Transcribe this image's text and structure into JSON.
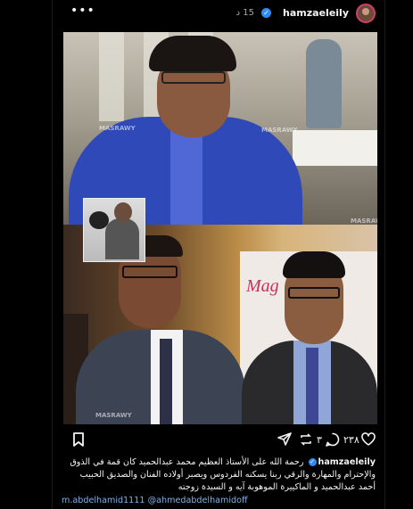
{
  "post": {
    "username": "hamzaeleily",
    "verified_glyph": "✓",
    "time": "15 د",
    "more_glyph": "•••",
    "watermarks": [
      "MASRAWY",
      "MASRAWY",
      "MASRAWY",
      "MASRAWY"
    ],
    "photo2_brand": "Mag",
    "likes": "٢٣٨",
    "comments": "٣"
  },
  "icons": {
    "like": "heart-icon",
    "comment": "comment-icon",
    "repost": "repost-icon",
    "share": "share-icon",
    "save": "bookmark-icon",
    "more": "more-icon",
    "verified": "verified-badge-icon"
  },
  "caption": {
    "username": "hamzaeleily",
    "text": "رحمة الله على الأستاذ العظيم محمد عبدالحميد كان قمة في الذوق والإحترام والمهارة والرقي ربنا يسكنه الفردوس ويصبر أولاده الفنان والصديق الحبيب أحمد عبدالحميد و الماكييرة الموهوبة آيه و السيدة زوجته",
    "mention1": "@ahmedabdelhamidoff",
    "mention2": "m.abdelhamid1111"
  },
  "colors": {
    "background": "#000000",
    "text": "#f5f5f5",
    "muted": "#a8a8a8",
    "verified": "#2f8cf0",
    "link": "#7fb1ef"
  }
}
